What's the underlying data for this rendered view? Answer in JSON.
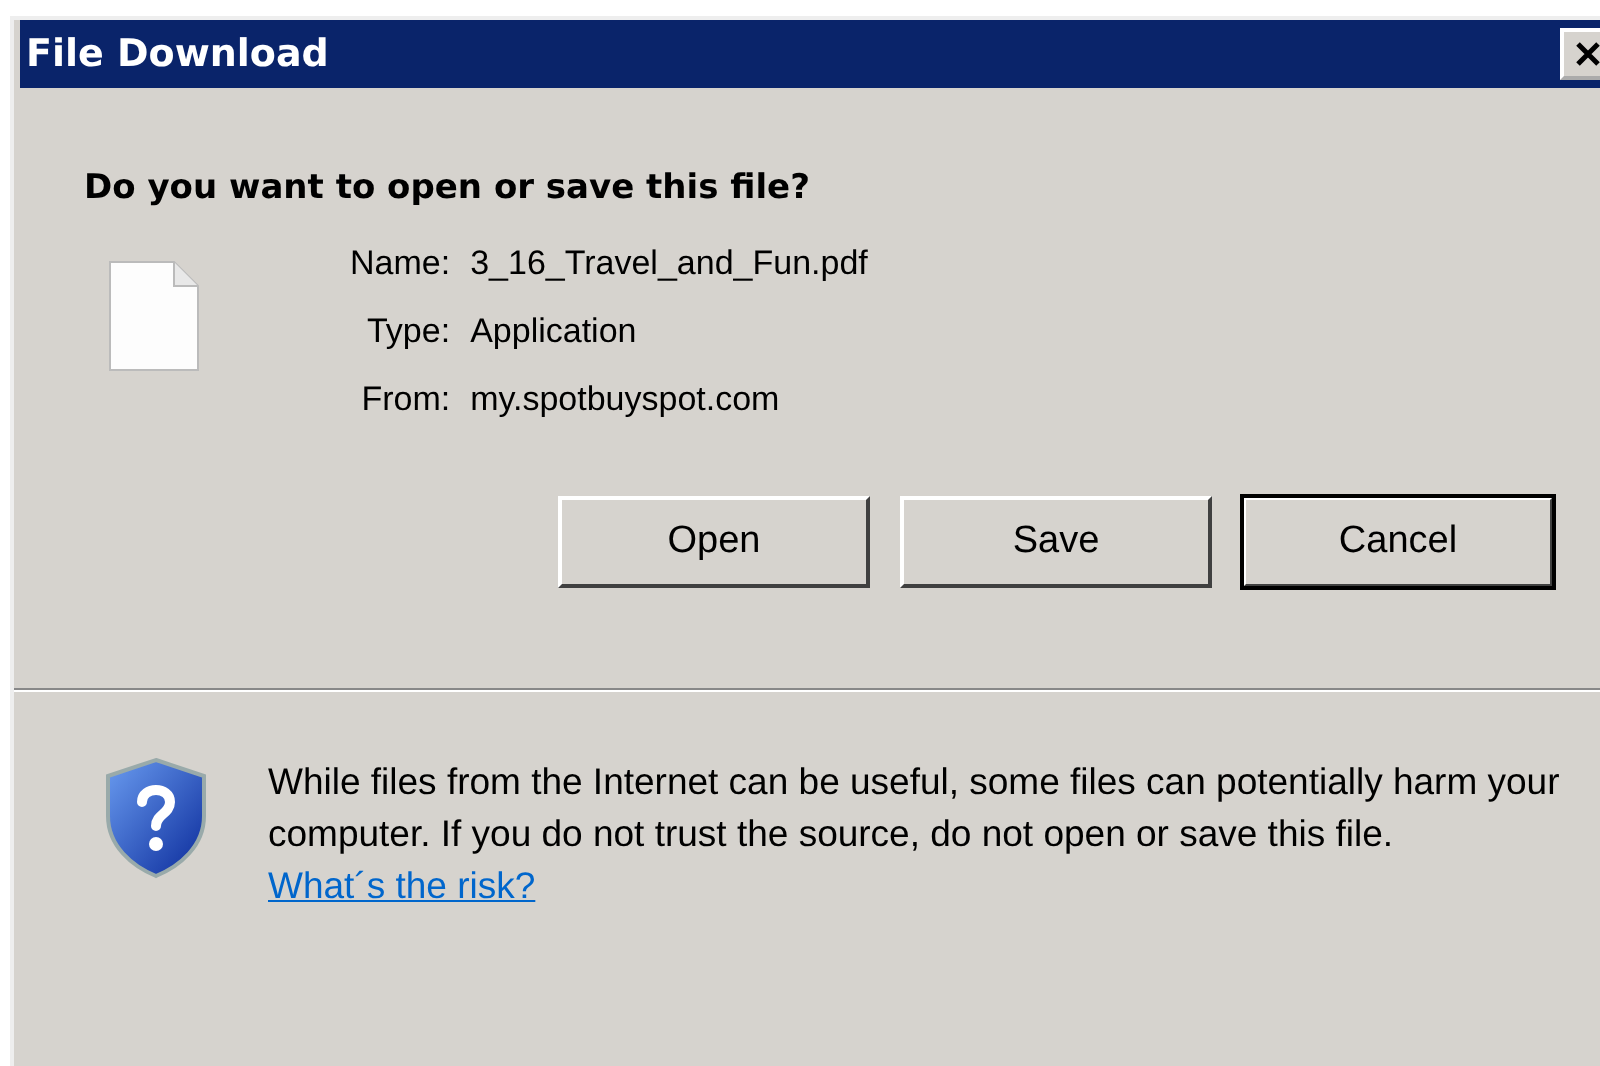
{
  "window": {
    "title": "File Download"
  },
  "question": "Do you want to open or save this file?",
  "fields": [
    {
      "label": "Name:",
      "value": "3_16_Travel_and_Fun.pdf"
    },
    {
      "label": "Type:",
      "value": "Application"
    },
    {
      "label": "From:",
      "value": "my.spotbuyspot.com"
    }
  ],
  "buttons": [
    {
      "label": "Open",
      "default": false
    },
    {
      "label": "Save",
      "default": false
    },
    {
      "label": "Cancel",
      "default": true
    }
  ],
  "warning": {
    "text": "While files from the Internet can be useful, some files can potentially harm your computer. If you do not trust the source, do not open or save this file.",
    "link": "What´s the risk?"
  }
}
